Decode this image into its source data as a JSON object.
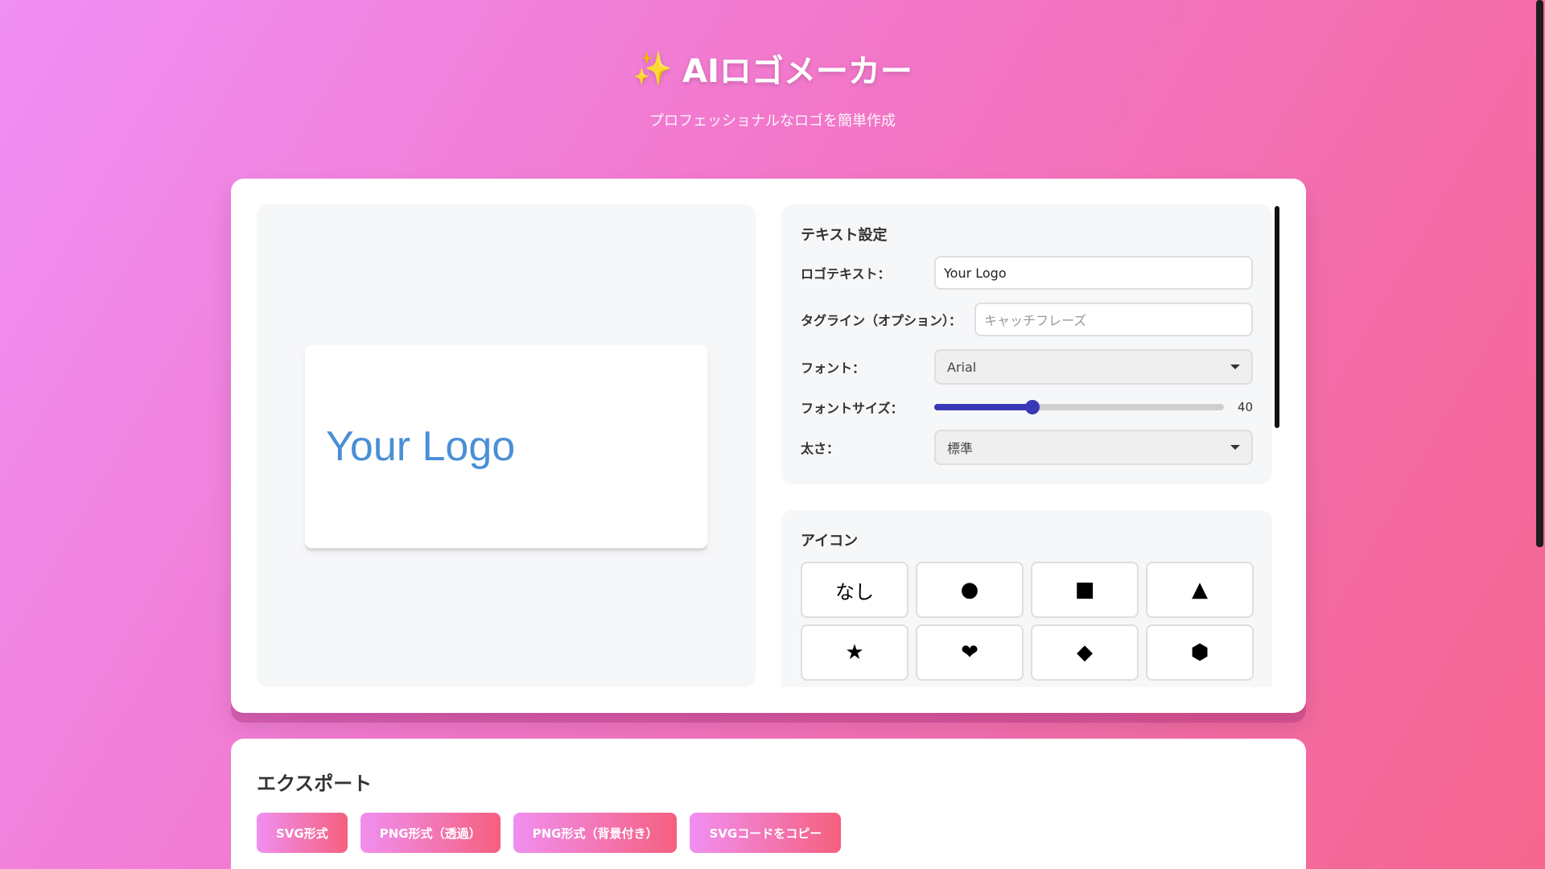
{
  "header": {
    "sparkle_icon": "✨",
    "title": "AIロゴメーカー",
    "subtitle": "プロフェッショナルなロゴを簡単作成"
  },
  "preview": {
    "logo_text": "Your Logo",
    "logo_color": "#4a8fd6"
  },
  "text_settings": {
    "title": "テキスト設定",
    "logo_text_label": "ロゴテキスト：",
    "logo_text_value": "Your Logo",
    "tagline_label": "タグライン（オプション）：",
    "tagline_placeholder": "キャッチフレーズ",
    "font_label": "フォント：",
    "font_value": "Arial",
    "font_size_label": "フォントサイズ：",
    "font_size_value": "40",
    "font_size_fraction": 0.34,
    "weight_label": "太さ：",
    "weight_value": "標準"
  },
  "icon_section": {
    "title": "アイコン",
    "options": [
      "なし",
      "●",
      "■",
      "▲",
      "★",
      "❤",
      "◆",
      "⬢"
    ]
  },
  "export": {
    "title": "エクスポート",
    "buttons": [
      "SVG形式",
      "PNG形式（透過）",
      "PNG形式（背景付き）",
      "SVGコードをコピー"
    ]
  },
  "colors": {
    "accent": "#3a38b6",
    "gradient_start": "#f08ff5",
    "gradient_end": "#f5658e"
  }
}
